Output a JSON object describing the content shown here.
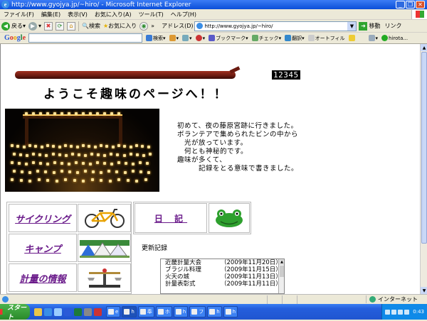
{
  "window": {
    "title": "http://www.gyojya.jp/~hiro/ - Microsoft Internet Explorer"
  },
  "menu": [
    "ファイル(F)",
    "編集(E)",
    "表示(V)",
    "お気に入り(A)",
    "ツール(T)",
    "ヘルプ(H)"
  ],
  "toolbar": {
    "back_label": "戻る",
    "search_label": "検索",
    "favorites_label": "お気に入り",
    "address_label": "アドレス(D)",
    "address_value": "http://www.gyojya.jp/~hiro/",
    "go_label": "移動",
    "links_label": "リンク"
  },
  "google_bar": {
    "logo_letters": [
      "G",
      "o",
      "o",
      "g",
      "l",
      "e"
    ],
    "search_btn": "検索",
    "bookmark_btn": "ブックマーク",
    "check_btn": "チェック",
    "translate_btn": "翻訳",
    "autofill_btn": "オートフィル",
    "user_label": "hirota..."
  },
  "page": {
    "counter": "12345",
    "welcome": "ようこそ趣味のページへ！！",
    "intro_lines": [
      "初めて、夜の藤原宮跡に行きました。",
      "ボランテアで集められたビンの中から",
      "　光が放っています。",
      "　何とも神秘的です。",
      "趣味が多くて、",
      "　　　記録をとる意味で書きました。"
    ],
    "nav": [
      {
        "label": "サイクリング",
        "icon": "bicycle-icon"
      },
      {
        "label": "キャンプ",
        "icon": "tents-icon"
      },
      {
        "label": "計量の情報",
        "icon": "scale-icon"
      }
    ],
    "diary_label": "日 記",
    "diary_icon": "frog-icon",
    "updates_label": "更新記録",
    "updates": [
      {
        "title": "近畿計量大会",
        "date": "（2009年11月20日）"
      },
      {
        "title": "ブラジル料理",
        "date": "（2009年11月15日）"
      },
      {
        "title": "火天の城",
        "date": "（2009年11月13日）"
      },
      {
        "title": "計量表彰式",
        "date": "（2009年11月11日）"
      }
    ]
  },
  "status": {
    "zone": "インターネット"
  },
  "taskbar": {
    "start_label": "スタート",
    "tasks": [
      "e",
      "h",
      "奉",
      "ホ",
      "h",
      "フ",
      "h",
      "h"
    ],
    "clock": "0:43"
  }
}
